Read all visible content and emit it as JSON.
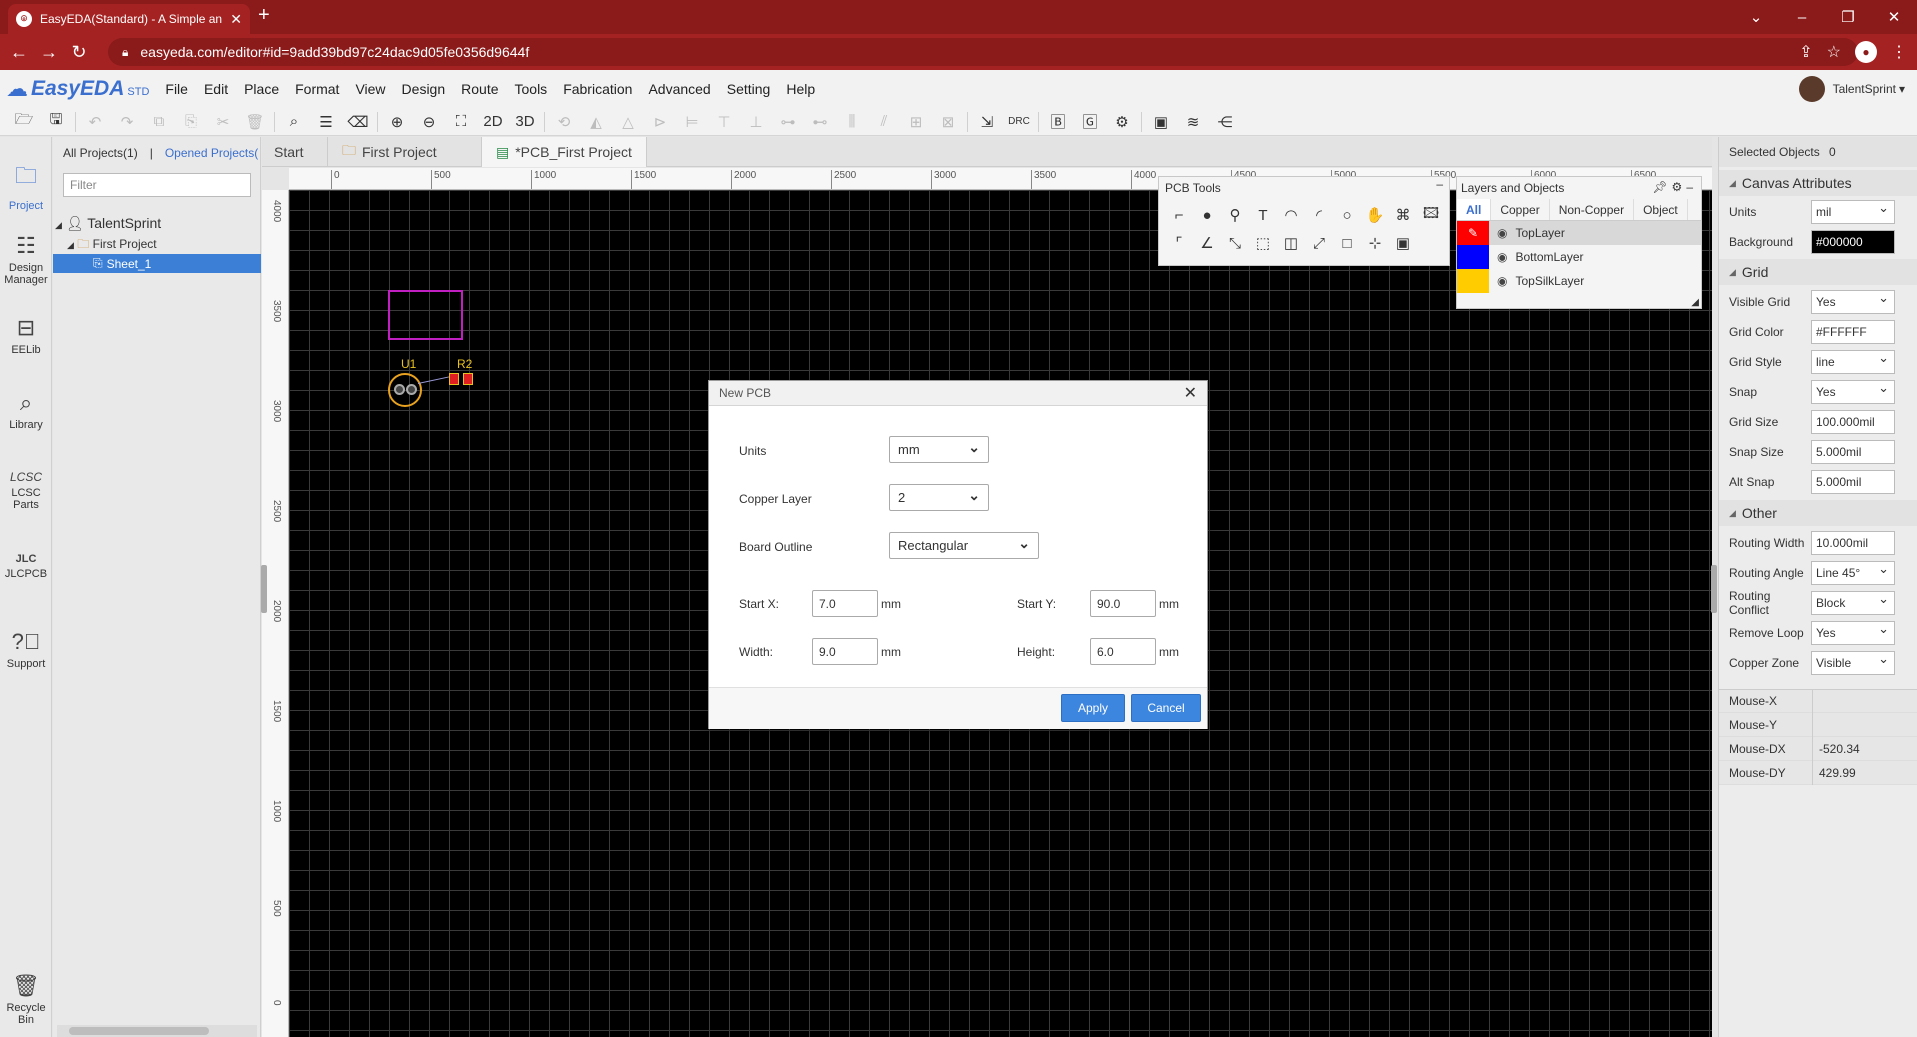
{
  "browser": {
    "tab_title": "EasyEDA(Standard) - A Simple an",
    "url": "easyeda.com/editor#id=9add39bd97c24dac9d05fe0356d9644f"
  },
  "app": {
    "logo": "EasyEDA",
    "edition": "STD",
    "menu": [
      "File",
      "Edit",
      "Place",
      "Format",
      "View",
      "Design",
      "Route",
      "Tools",
      "Fabrication",
      "Advanced",
      "Setting",
      "Help"
    ],
    "user": "TalentSprint"
  },
  "toolbar": {
    "btn_2d": "2D",
    "btn_3d": "3D",
    "btn_drc": "DRC"
  },
  "left_rail": [
    {
      "label": "Project",
      "icon": "folder-icon"
    },
    {
      "label": "Design Manager",
      "icon": "design-manager-icon"
    },
    {
      "label": "EELib",
      "icon": "eelib-icon"
    },
    {
      "label": "Library",
      "icon": "library-icon"
    },
    {
      "label": "LCSC Parts",
      "icon": "lcsc-icon"
    },
    {
      "label": "JLCPCB",
      "icon": "jlcpcb-icon"
    },
    {
      "label": "Support",
      "icon": "support-icon"
    },
    {
      "label": "Recycle Bin",
      "icon": "trash-icon"
    }
  ],
  "project_panel": {
    "all_projects": "All Projects(1)",
    "separator": "|",
    "opened_projects": "Opened Projects(",
    "filter_placeholder": "Filter",
    "tree": {
      "user": "TalentSprint",
      "project": "First Project",
      "sheet": "Sheet_1"
    }
  },
  "doc_tabs": [
    "Start",
    "First Project",
    "*PCB_First Project"
  ],
  "ruler": {
    "top": [
      "0",
      "500",
      "1000",
      "1500",
      "2000",
      "2500",
      "3000",
      "3500",
      "4000",
      "4500",
      "5000",
      "5500",
      "6000",
      "6500"
    ],
    "left": [
      "4000",
      "3500",
      "3000",
      "2500",
      "2000",
      "1500",
      "1000",
      "500",
      "0"
    ]
  },
  "canvas": {
    "u1": "U1",
    "r2": "R2"
  },
  "pcb_tools": {
    "title": "PCB Tools"
  },
  "layers_panel": {
    "title": "Layers and Objects",
    "tabs": [
      "All",
      "Copper",
      "Non-Copper",
      "Object"
    ],
    "layers": [
      {
        "name": "TopLayer",
        "color": "#ff0000"
      },
      {
        "name": "BottomLayer",
        "color": "#0000ff"
      },
      {
        "name": "TopSilkLayer",
        "color": "#ffcc00"
      }
    ]
  },
  "right_panel": {
    "selected_label": "Selected Objects",
    "selected_count": "0",
    "canvas_attrs": "Canvas Attributes",
    "units_label": "Units",
    "units": "mil",
    "background_label": "Background",
    "background": "#000000",
    "grid_section": "Grid",
    "visible_grid_label": "Visible Grid",
    "visible_grid": "Yes",
    "grid_color_label": "Grid Color",
    "grid_color": "#FFFFFF",
    "grid_style_label": "Grid Style",
    "grid_style": "line",
    "snap_label": "Snap",
    "snap": "Yes",
    "grid_size_label": "Grid Size",
    "grid_size": "100.000mil",
    "snap_size_label": "Snap Size",
    "snap_size": "5.000mil",
    "alt_snap_label": "Alt Snap",
    "alt_snap": "5.000mil",
    "other_section": "Other",
    "routing_width_label": "Routing Width",
    "routing_width": "10.000mil",
    "routing_angle_label": "Routing Angle",
    "routing_angle": "Line 45°",
    "routing_conflict_label": "Routing Conflict",
    "routing_conflict": "Block",
    "remove_loop_label": "Remove Loop",
    "remove_loop": "Yes",
    "copper_zone_label": "Copper Zone",
    "copper_zone": "Visible",
    "mouse_x_label": "Mouse-X",
    "mouse_x": "",
    "mouse_y_label": "Mouse-Y",
    "mouse_y": "",
    "mouse_dx_label": "Mouse-DX",
    "mouse_dx": "-520.34",
    "mouse_dy_label": "Mouse-DY",
    "mouse_dy": "429.99"
  },
  "dialog": {
    "title": "New PCB",
    "units_label": "Units",
    "units": "mm",
    "copper_label": "Copper Layer",
    "copper": "2",
    "outline_label": "Board Outline",
    "outline": "Rectangular",
    "start_x_label": "Start X:",
    "start_x": "7.0",
    "start_y_label": "Start Y:",
    "start_y": "90.0",
    "width_label": "Width:",
    "width": "9.0",
    "height_label": "Height:",
    "height": "6.0",
    "unit": "mm",
    "apply": "Apply",
    "cancel": "Cancel"
  }
}
